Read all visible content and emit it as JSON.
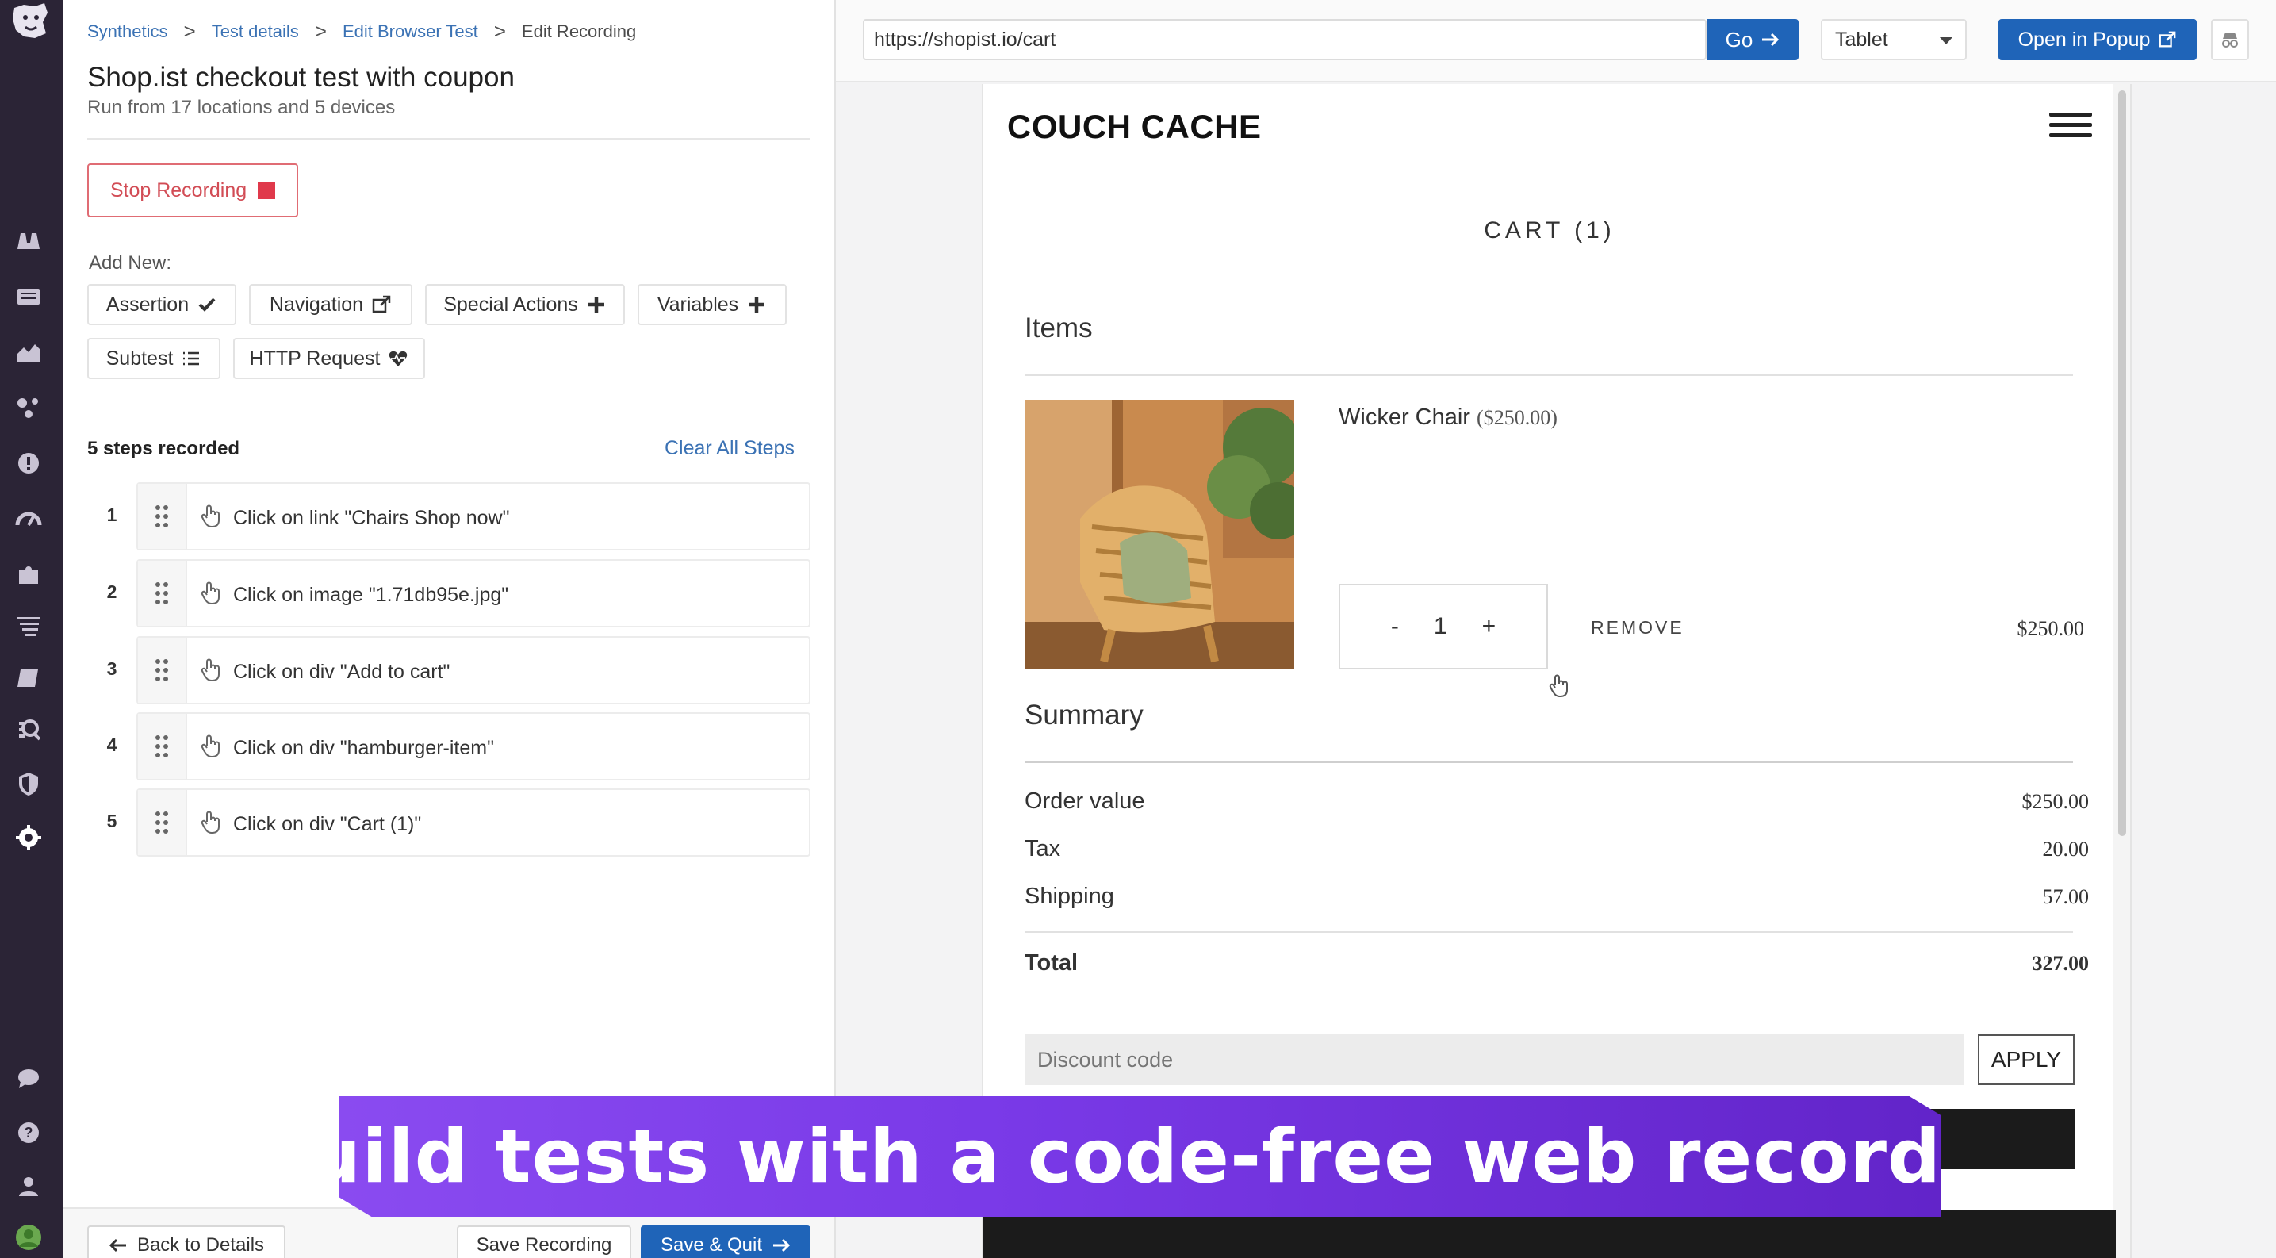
{
  "breadcrumb": {
    "items": [
      "Synthetics",
      "Test details",
      "Edit Browser Test"
    ],
    "current": "Edit Recording",
    "separator": ">"
  },
  "test": {
    "title": "Shop.ist checkout test with coupon",
    "subtitle": "Run from 17 locations and 5 devices"
  },
  "recording": {
    "stop_label": "Stop Recording",
    "add_new_label": "Add New:",
    "add_buttons": [
      "Assertion",
      "Navigation",
      "Special Actions",
      "Variables",
      "Subtest",
      "HTTP Request"
    ]
  },
  "steps": {
    "header": "5 steps recorded",
    "clear_label": "Clear All Steps",
    "items": [
      {
        "num": "1",
        "text": "Click on link \"Chairs Shop now\""
      },
      {
        "num": "2",
        "text": "Click on image \"1.71db95e.jpg\""
      },
      {
        "num": "3",
        "text": "Click on div \"Add to cart\""
      },
      {
        "num": "4",
        "text": "Click on div \"hamburger-item\""
      },
      {
        "num": "5",
        "text": "Click on div \"Cart (1)\""
      }
    ]
  },
  "footer": {
    "back_label": "Back to Details",
    "save_label": "Save Recording",
    "save_quit_label": "Save & Quit"
  },
  "browser": {
    "url": "https://shopist.io/cart",
    "go_label": "Go",
    "device": "Tablet",
    "popup_label": "Open in Popup"
  },
  "shop": {
    "logo": "COUCH CACHE",
    "cart_heading": "CART (1)",
    "items_title": "Items",
    "product": {
      "name": "Wicker Chair",
      "unit_price": "($250.00)",
      "qty_minus": "-",
      "qty": "1",
      "qty_plus": "+",
      "remove": "REMOVE",
      "line_price": "$250.00"
    },
    "summary_title": "Summary",
    "summary": [
      {
        "label": "Order value",
        "value": "$250.00"
      },
      {
        "label": "Tax",
        "value": "20.00"
      },
      {
        "label": "Shipping",
        "value": "57.00"
      }
    ],
    "total_label": "Total",
    "total_value": "327.00",
    "discount_placeholder": "Discount code",
    "apply_label": "APPLY"
  },
  "banner": {
    "text": "Build tests with a code-free web recorder"
  },
  "colors": {
    "nav_bg": "#2b2436",
    "accent_blue": "#1f64b8",
    "link_blue": "#3b72b4",
    "stop_red": "#e0394b",
    "banner_purple": "#7a3ae8"
  },
  "icons": {
    "nav": [
      "binoculars-icon",
      "list-icon",
      "area-chart-icon",
      "network-icon",
      "alert-icon",
      "gauge-icon",
      "puzzle-icon",
      "filter-icon",
      "book-icon",
      "search-analytics-icon",
      "shield-icon",
      "synthetics-icon",
      "chat-icon",
      "help-icon",
      "team-icon",
      "user-avatar"
    ]
  }
}
